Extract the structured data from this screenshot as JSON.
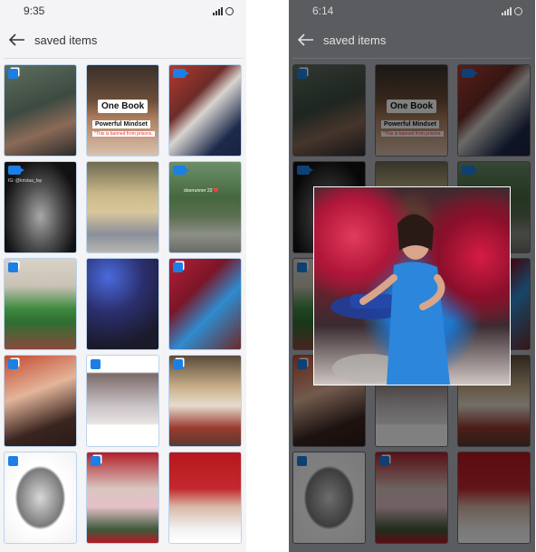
{
  "left": {
    "status": {
      "time": "9:35"
    },
    "header": {
      "title": "saved items"
    }
  },
  "right": {
    "status": {
      "time": "6:14"
    },
    "header": {
      "title": "saved items"
    }
  },
  "tiles": [
    {
      "name": "tile-1",
      "badge": "multi"
    },
    {
      "name": "tile-2",
      "badge": "none",
      "title": "One Book",
      "subtitle": "Powerful Mindset",
      "note": "*This is banned from prisons."
    },
    {
      "name": "tile-3",
      "badge": "video"
    },
    {
      "name": "tile-4",
      "badge": "video",
      "handle": "IG: @kristaa_fay"
    },
    {
      "name": "tile-5",
      "badge": "none"
    },
    {
      "name": "tile-6",
      "badge": "video",
      "caption": "doorrunner 23 ❤️"
    },
    {
      "name": "tile-7",
      "badge": "multi"
    },
    {
      "name": "tile-8",
      "badge": "none"
    },
    {
      "name": "tile-9",
      "badge": "multi"
    },
    {
      "name": "tile-10",
      "badge": "multi"
    },
    {
      "name": "tile-11",
      "badge": "multi"
    },
    {
      "name": "tile-12",
      "badge": "multi"
    },
    {
      "name": "tile-13",
      "badge": "multi"
    },
    {
      "name": "tile-14",
      "badge": "multi"
    },
    {
      "name": "tile-15",
      "badge": "none"
    }
  ],
  "colors": {
    "accent": "#1b7fe6",
    "tile_border": "#b9d4ee",
    "dim_background": "#5b5c60"
  },
  "icons": {
    "back": "back-arrow-icon",
    "signal": "signal-icon",
    "battery": "battery-ring-icon"
  }
}
